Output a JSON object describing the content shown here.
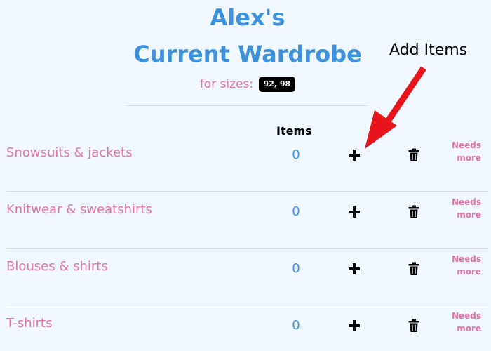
{
  "header": {
    "title_line1": "Alex's",
    "title_line2": "Current Wardrobe",
    "sizes_label": "for sizes:",
    "sizes_value": "92, 98"
  },
  "table": {
    "items_header": "Items"
  },
  "annotation": {
    "label": "Add Items",
    "arrow_color": "#e8141c"
  },
  "categories": [
    {
      "name": "Snowsuits & jackets",
      "count": "0",
      "status_line1": "Needs",
      "status_line2": "more"
    },
    {
      "name": "Knitwear & sweatshirts",
      "count": "0",
      "status_line1": "Needs",
      "status_line2": "more"
    },
    {
      "name": "Blouses & shirts",
      "count": "0",
      "status_line1": "Needs",
      "status_line2": "more"
    },
    {
      "name": "T-shirts",
      "count": "0",
      "status_line1": "Needs",
      "status_line2": "more"
    }
  ],
  "icons": {
    "add": "plus-icon",
    "delete": "trash-icon"
  },
  "colors": {
    "background": "#f0f7fe",
    "title": "#3c92dc",
    "accent_pink": "#e274a7",
    "count_blue": "#3c92dc"
  }
}
